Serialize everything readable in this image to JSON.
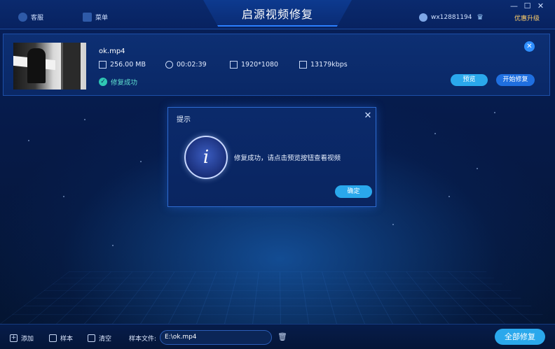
{
  "app": {
    "title": "启源视频修复",
    "service_label": "客服",
    "menu_label": "菜单",
    "username": "wx12881194",
    "upgrade_label": "优惠升级",
    "window_controls": {
      "minimize": "—",
      "maximize": "☐",
      "close": "✕"
    }
  },
  "video": {
    "filename": "ok.mp4",
    "size": "256.00 MB",
    "duration": "00:02:39",
    "resolution": "1920*1080",
    "bitrate": "13179kbps",
    "status": "修复成功",
    "preview_label": "预览",
    "start_label": "开始修复"
  },
  "dialog": {
    "title": "提示",
    "icon_letter": "i",
    "message": "修复成功，请点击预览按钮查看视频",
    "ok_label": "确定"
  },
  "bottom": {
    "add_label": "添加",
    "sample_label": "样本",
    "clear_label": "清空",
    "sample_file_label": "样本文件:",
    "sample_file_value": "E:\\ok.mp4",
    "repair_all_label": "全部修复"
  },
  "colors": {
    "accent": "#2aa8ec",
    "primary_button": "#1f6fe0",
    "success": "#2fc7b4",
    "upgrade": "#ffcf6a"
  }
}
